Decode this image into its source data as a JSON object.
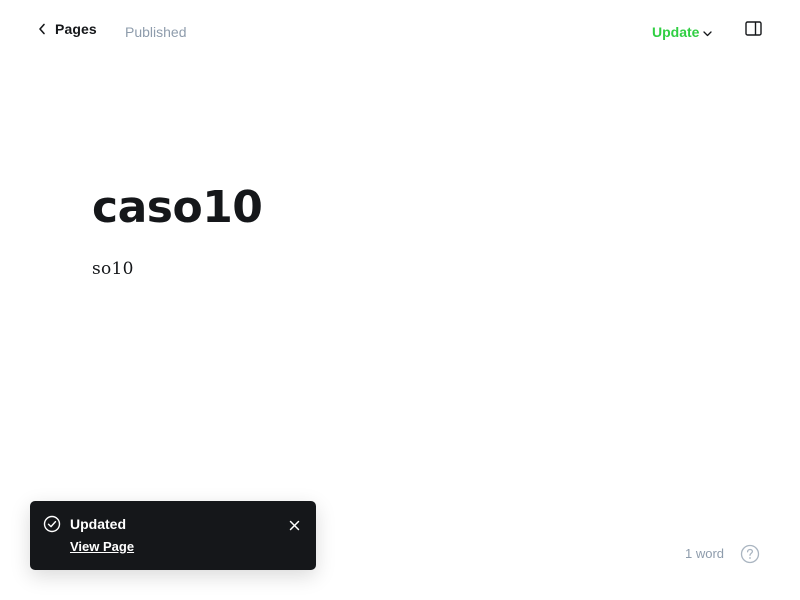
{
  "header": {
    "back_label": "Pages",
    "status": "Published",
    "update_label": "Update"
  },
  "editor": {
    "title": "caso10",
    "body": "so10"
  },
  "toast": {
    "title": "Updated",
    "link_label": "View Page"
  },
  "footer": {
    "word_count": "1 word"
  },
  "colors": {
    "accent": "#30cf43",
    "muted": "#8e9cac",
    "toast_bg": "#15171a"
  },
  "icons": {
    "back": "chevron-left-icon",
    "update_dropdown": "chevron-down-icon",
    "sidebar": "sidebar-toggle-icon",
    "toast_success": "check-circle-icon",
    "toast_close": "close-icon",
    "help": "help-circle-icon"
  }
}
